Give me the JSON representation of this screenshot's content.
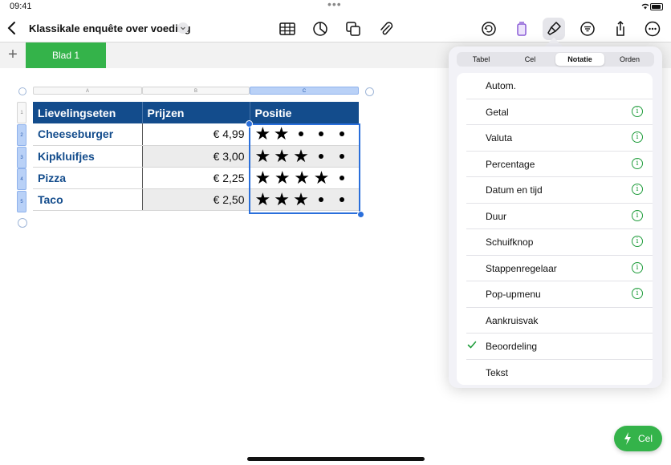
{
  "status": {
    "time": "09:41",
    "dots": "•••"
  },
  "document": {
    "title": "Klassikale enquête over voeding"
  },
  "toolbar": {
    "icons": [
      "table-icon",
      "chart-icon",
      "shapes-icon",
      "paperclip-icon",
      "undo-icon",
      "document-icon",
      "format-brush-icon",
      "organize-icon",
      "share-icon",
      "more-icon"
    ]
  },
  "sheets": {
    "add": "+",
    "tabs": [
      "Blad 1"
    ]
  },
  "grid": {
    "columns": [
      "A",
      "B",
      "C"
    ],
    "rows": [
      "1",
      "2",
      "3",
      "4",
      "5"
    ]
  },
  "table": {
    "headers": [
      "Lievelingseten",
      "Prijzen",
      "Positie"
    ],
    "rows": [
      {
        "item": "Cheeseburger",
        "price": "€ 4,99",
        "rating": 2
      },
      {
        "item": "Kipkluifjes",
        "price": "€ 3,00",
        "rating": 3
      },
      {
        "item": "Pizza",
        "price": "€ 2,25",
        "rating": 4
      },
      {
        "item": "Taco",
        "price": "€ 2,50",
        "rating": 3
      }
    ],
    "rating_max": 5
  },
  "format_panel": {
    "tabs": [
      "Tabel",
      "Cel",
      "Notatie",
      "Orden"
    ],
    "active_tab": "Notatie",
    "options": [
      {
        "label": "Autom.",
        "info": false,
        "checked": false
      },
      {
        "label": "Getal",
        "info": true,
        "checked": false
      },
      {
        "label": "Valuta",
        "info": true,
        "checked": false
      },
      {
        "label": "Percentage",
        "info": true,
        "checked": false
      },
      {
        "label": "Datum en tijd",
        "info": true,
        "checked": false
      },
      {
        "label": "Duur",
        "info": true,
        "checked": false
      },
      {
        "label": "Schuifknop",
        "info": true,
        "checked": false
      },
      {
        "label": "Stappenregelaar",
        "info": true,
        "checked": false
      },
      {
        "label": "Pop-upmenu",
        "info": true,
        "checked": false
      },
      {
        "label": "Aankruisvak",
        "info": false,
        "checked": false
      },
      {
        "label": "Beoordeling",
        "info": false,
        "checked": true
      },
      {
        "label": "Tekst",
        "info": false,
        "checked": false
      }
    ]
  },
  "cell_button": {
    "label": "Cel"
  },
  "colors": {
    "accent_green": "#34b34a",
    "header_blue": "#134c8c",
    "selection_blue": "#2a6fdb"
  }
}
